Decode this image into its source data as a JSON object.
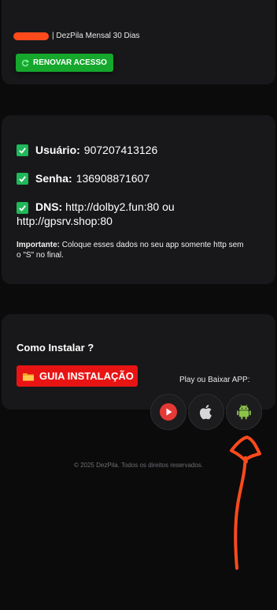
{
  "plan": {
    "name": "| DezPila Mensal 30 Dias",
    "renew_label": "RENOVAR ACESSO"
  },
  "credentials": {
    "user_label": "Usuário:",
    "user_value": "907207413126",
    "pass_label": "Senha:",
    "pass_value": "136908871607",
    "dns_label": "DNS:",
    "dns_value": "http://dolby2.fun:80 ou http://gpsrv.shop:80",
    "note_label": "Importante:",
    "note_text": "Coloque esses dados no seu app somente http sem o \"S\" no final."
  },
  "install": {
    "title": "Como Instalar ?",
    "guide_label": "GUIA INSTALAÇÃO",
    "play_label": "Play ou Baixar APP:",
    "apps": [
      "play-icon",
      "apple-icon",
      "android-icon"
    ]
  },
  "footer": {
    "text": "© 2025 DezPila. Todos os direitos reservados."
  },
  "colors": {
    "background": "#0b0b0c",
    "card": "#18181a",
    "renew_button": "#15a82d",
    "guide_button": "#e81414",
    "check": "#1fb85a",
    "annotation": "#ff4a1c"
  }
}
